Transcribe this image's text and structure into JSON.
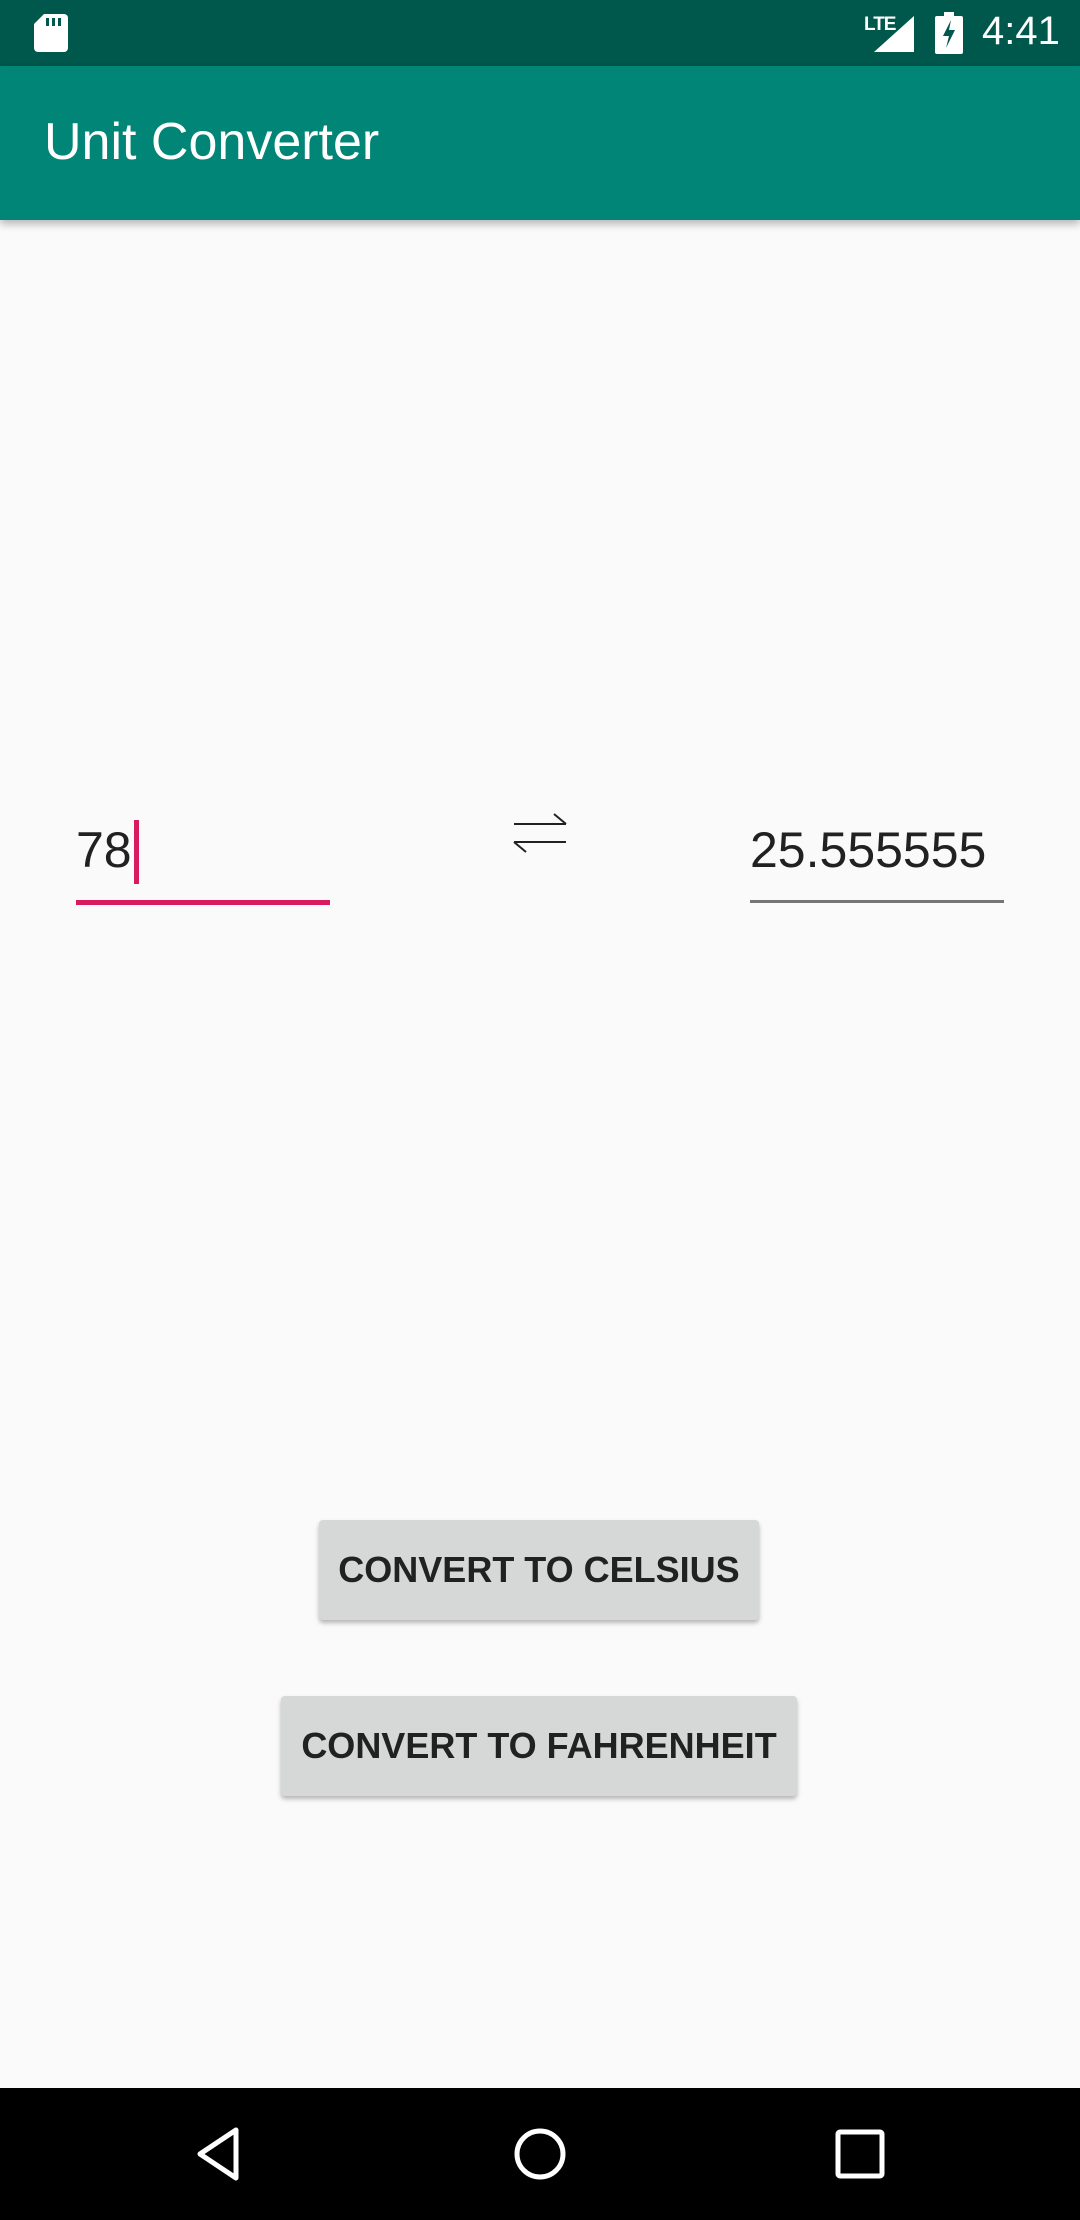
{
  "status_bar": {
    "network_type": "LTE",
    "time": "4:41",
    "icons": [
      "sd-card-icon",
      "signal-icon",
      "battery-charging-icon"
    ]
  },
  "app_bar": {
    "title": "Unit Converter"
  },
  "converter": {
    "input_value": "78",
    "output_value": "25.555555",
    "swap_icon": "swap-arrows-icon"
  },
  "buttons": {
    "convert_celsius": "CONVERT TO CELSIUS",
    "convert_fahrenheit": "CONVERT TO FAHRENHEIT"
  },
  "nav_bar": {
    "icons": [
      "back-icon",
      "home-icon",
      "recents-icon"
    ]
  },
  "colors": {
    "status_bar": "#00574b",
    "app_bar": "#008577",
    "accent": "#d81b60",
    "button": "#d6d7d7",
    "background": "#fafafa"
  }
}
